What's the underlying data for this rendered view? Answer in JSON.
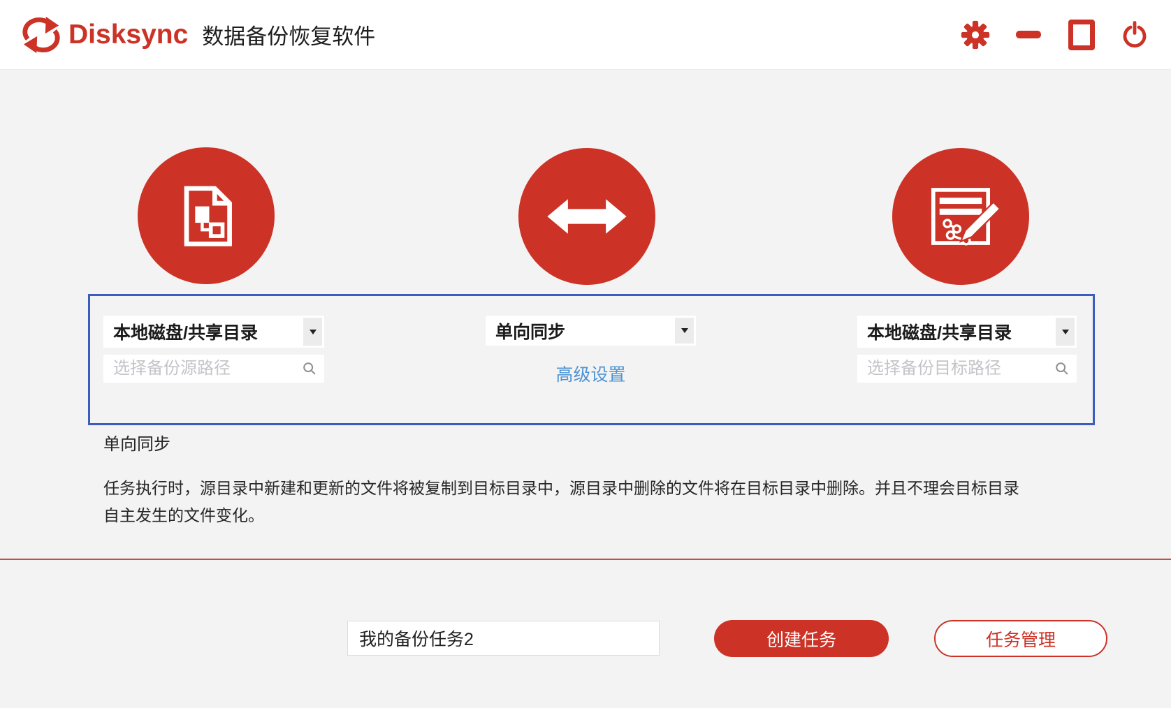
{
  "app": {
    "brand": "Disksync",
    "title": "数据备份恢复软件"
  },
  "colors": {
    "accent_red": "#cc3226",
    "box_border_blue": "#3a5dc0",
    "link_blue": "#4f94d4",
    "divider_red": "#c0504d",
    "background_gray": "#f3f3f3"
  },
  "window_controls": {
    "icons": [
      "gear-icon",
      "minimize-icon",
      "maximize-icon",
      "power-icon"
    ]
  },
  "panels": {
    "source": {
      "icon": "document-tree-icon",
      "type_value": "本地磁盘/共享目录",
      "path_placeholder": "选择备份源路径",
      "path_value": ""
    },
    "mode": {
      "icon": "two-way-arrow-icon",
      "mode_value": "单向同步",
      "advanced_label": "高级设置"
    },
    "target": {
      "icon": "edit-plan-icon",
      "type_value": "本地磁盘/共享目录",
      "path_placeholder": "选择备份目标路径",
      "path_value": ""
    }
  },
  "mode_info": {
    "title": "单向同步",
    "description": "任务执行时，源目录中新建和更新的文件将被复制到目标目录中，源目录中删除的文件将在目标目录中删除。并且不理会目标目录自主发生的文件变化。"
  },
  "task_bar": {
    "name_value": "我的备份任务2",
    "create_label": "创建任务",
    "manage_label": "任务管理"
  }
}
